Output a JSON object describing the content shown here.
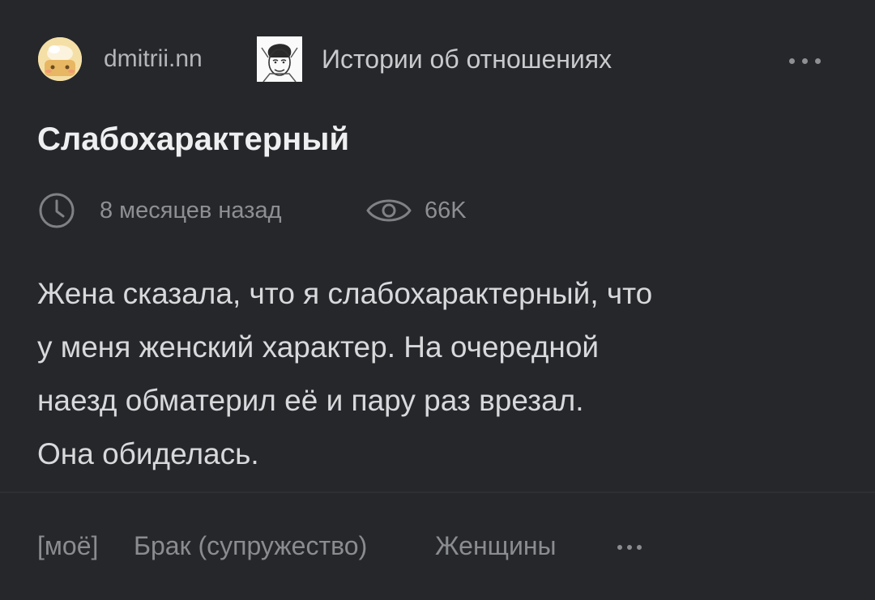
{
  "post": {
    "author": "dmitrii.nn",
    "community": "Истории об отношениях",
    "title": "Слабохарактерный",
    "time_ago": "8 месяцев назад",
    "views": "66K",
    "body": [
      "Жена сказала, что я слабохарактерный, что",
      "у меня женский характер. На очередной",
      "наезд обматерил её и пару раз врезал.",
      "Она обиделась."
    ],
    "tags": [
      "[моё]",
      "Брак (супружество)",
      "Женщины"
    ]
  },
  "icons": {
    "more": "more-horizontal-icon",
    "clock": "clock-icon",
    "eye": "eye-icon"
  },
  "colors": {
    "background": "#25272b",
    "title": "#eeeff0",
    "body_text": "#d8d9db",
    "muted": "#8d8f93"
  }
}
